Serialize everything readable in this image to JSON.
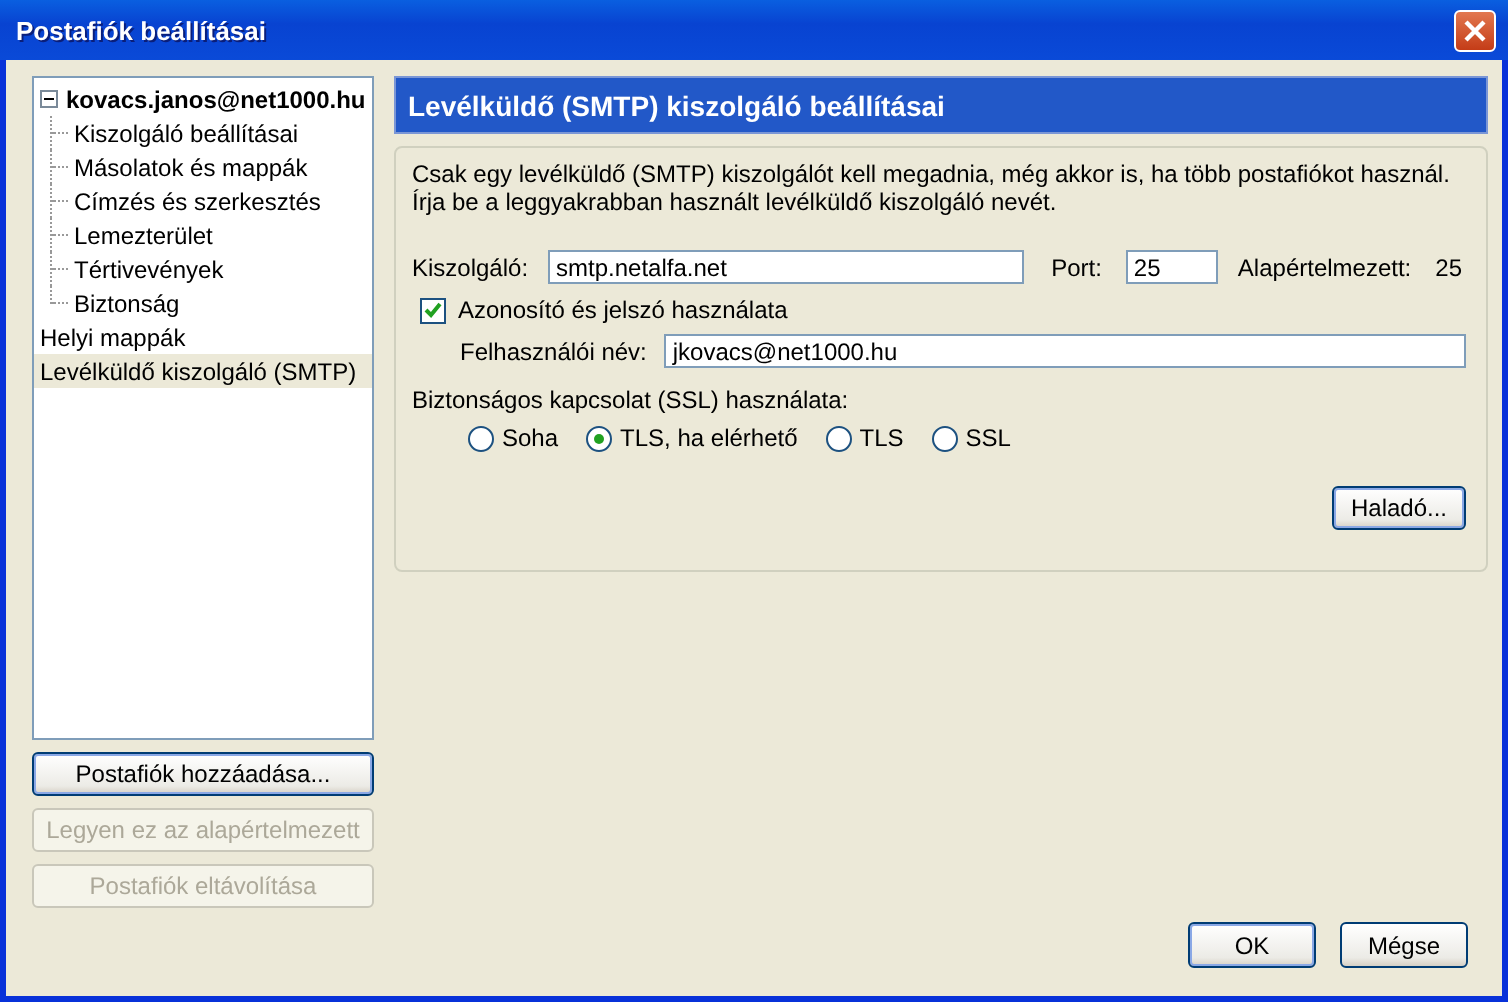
{
  "window": {
    "title": "Postafiók beállításai"
  },
  "tree": [
    {
      "label": "kovacs.janos@net1000.hu",
      "expanded": true,
      "selected": false,
      "children": [
        {
          "label": "Kiszolgáló beállításai",
          "selected": false
        },
        {
          "label": "Másolatok és mappák",
          "selected": false
        },
        {
          "label": "Címzés és szerkesztés",
          "selected": false
        },
        {
          "label": "Lemezterület",
          "selected": false
        },
        {
          "label": "Tértivevények",
          "selected": false
        },
        {
          "label": "Biztonság",
          "selected": false
        }
      ]
    },
    {
      "label": "Helyi mappák",
      "selected": false
    },
    {
      "label": "Levélküldő kiszolgáló (SMTP)",
      "selected": true
    }
  ],
  "side_buttons": [
    {
      "label": "Postafiók hozzáadása...",
      "disabled": false
    },
    {
      "label": "Legyen ez az alapértelmezett",
      "disabled": true
    },
    {
      "label": "Postafiók eltávolítása",
      "disabled": true
    }
  ],
  "panel": {
    "title": "Levélküldő (SMTP) kiszolgáló beállításai",
    "description": "Csak egy levélküldő (SMTP) kiszolgálót kell megadnia, még akkor is, ha több postafiókot használ. Írja be a leggyakrabban használt levélküldő kiszolgáló nevét.",
    "server_label": "Kiszolgáló:",
    "server_value": "smtp.netalfa.net",
    "port_label": "Port:",
    "port_value": "25",
    "default_label": "Alapértelmezett:",
    "default_value": "25",
    "auth": {
      "label": "Azonosító és jelszó használata",
      "checked": true
    },
    "username_label": "Felhasználói név:",
    "username_value": "jkovacs@net1000.hu",
    "ssl_label": "Biztonságos kapcsolat (SSL) használata:",
    "ssl_options": [
      {
        "label": "Soha",
        "selected": false
      },
      {
        "label": "TLS, ha elérhető",
        "selected": true
      },
      {
        "label": "TLS",
        "selected": false
      },
      {
        "label": "SSL",
        "selected": false
      }
    ],
    "advanced_button": "Haladó..."
  },
  "buttons": [
    "OK",
    "Mégse"
  ]
}
